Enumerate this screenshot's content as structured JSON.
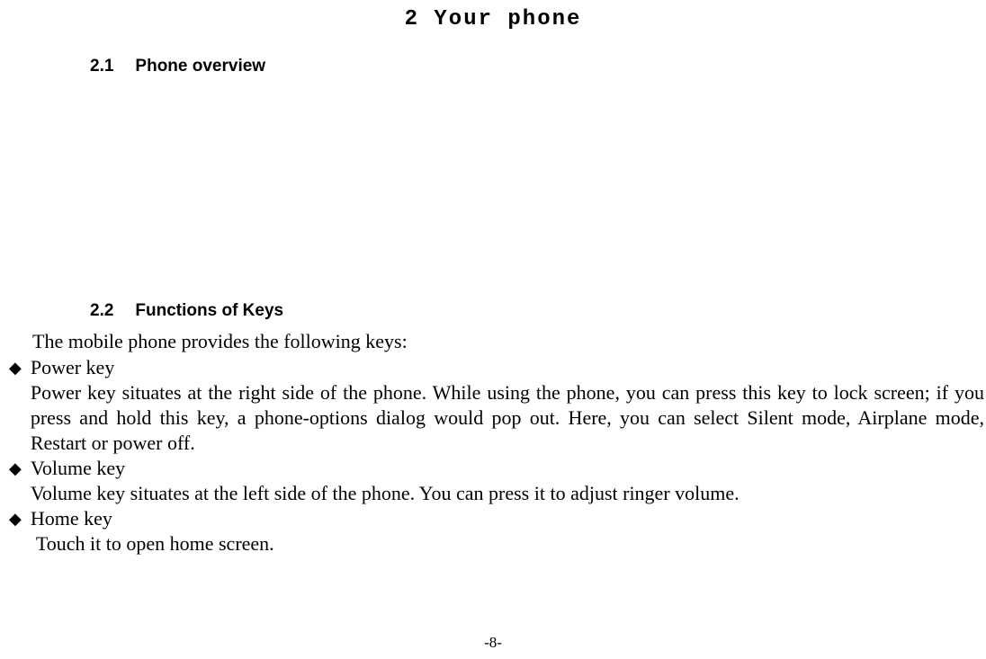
{
  "chapter": {
    "title": "2 Your phone"
  },
  "sections": {
    "s1": {
      "number": "2.1",
      "title": "Phone overview"
    },
    "s2": {
      "number": "2.2",
      "title": "Functions of Keys",
      "intro": "The mobile phone provides the following keys:",
      "items": [
        {
          "title": "Power key",
          "desc": "Power key situates at the right side of the phone. While using the phone, you can press this key to lock screen; if you press and hold this key, a phone-options dialog would pop out. Here, you can select Silent mode, Airplane mode, Restart or power off."
        },
        {
          "title": "Volume key",
          "desc": "Volume key situates at the left side of the phone. You can press it to adjust ringer volume."
        },
        {
          "title": "Home key",
          "desc": " Touch it to open home screen."
        }
      ]
    }
  },
  "pageNumber": "-8-"
}
